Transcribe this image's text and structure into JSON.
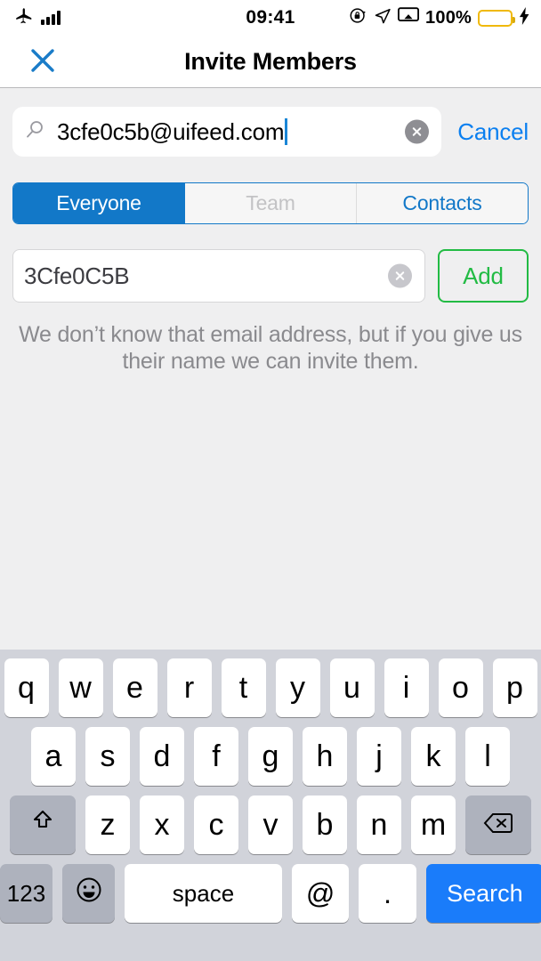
{
  "statusbar": {
    "airplane_icon": "airplane-mode-icon",
    "signal_icon": "cellular-signal-bars",
    "time": "09:41",
    "rotation_lock_icon": "rotation-lock-icon",
    "location_icon": "location-arrow-icon",
    "airplay_icon": "screen-mirroring-icon",
    "battery_percent": "100%",
    "battery_icon": "battery-full-icon",
    "charging_icon": "lightning-bolt-icon",
    "battery_color": "#fcc60b"
  },
  "navbar": {
    "title": "Invite Members",
    "close_icon": "close-x-icon",
    "close_color": "#1a7cc8"
  },
  "search": {
    "icon": "search-magnifier-icon",
    "value": "3cfe0c5b@uifeed.com",
    "clear_icon": "clear-circle-icon",
    "cancel_label": "Cancel",
    "cancel_color": "#0a7ff0",
    "caret_color": "#1a86d6"
  },
  "segmented": {
    "selected_color": "#1278c8",
    "items": [
      {
        "label": "Everyone",
        "state": "selected"
      },
      {
        "label": "Team",
        "state": "disabled"
      },
      {
        "label": "Contacts",
        "state": "normal"
      }
    ]
  },
  "name_row": {
    "value": "3Cfe0C5B",
    "clear_icon": "clear-circle-icon",
    "add_label": "Add",
    "add_color": "#22bb44"
  },
  "helper": {
    "text": "We don’t know that email address, but if you give us their name we can invite them."
  },
  "keyboard": {
    "row1": [
      "q",
      "w",
      "e",
      "r",
      "t",
      "y",
      "u",
      "i",
      "o",
      "p"
    ],
    "row2": [
      "a",
      "s",
      "d",
      "f",
      "g",
      "h",
      "j",
      "k",
      "l"
    ],
    "row3": [
      "z",
      "x",
      "c",
      "v",
      "b",
      "n",
      "m"
    ],
    "shift_icon": "shift-arrow-icon",
    "backspace_icon": "backspace-delete-icon",
    "numbers_label": "123",
    "emoji_icon": "emoji-smiley-icon",
    "space_label": "space",
    "at_label": "@",
    "period_label": ".",
    "search_label": "Search",
    "search_key_color": "#1a7cfa"
  }
}
